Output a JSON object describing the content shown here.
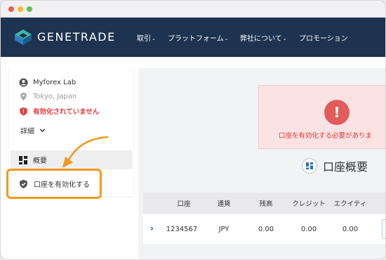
{
  "brand": {
    "name": "GENETRADE"
  },
  "nav": {
    "items": [
      {
        "label": "取引",
        "has_caret": true
      },
      {
        "label": "プラットフォーム",
        "has_caret": true
      },
      {
        "label": "弊社について",
        "has_caret": true
      },
      {
        "label": "プロモーション",
        "has_caret": false
      }
    ],
    "caret": "⌄"
  },
  "profile": {
    "name": "Myforex Lab",
    "location": "Tokyo, Japan",
    "status_warning": "有効化されていません",
    "details_label": "詳細"
  },
  "sidebar_menu": {
    "overview": "概要",
    "activate_account": "口座を有効化する"
  },
  "alert": {
    "icon": "!",
    "message": "口座を有効化する必要がありま"
  },
  "section": {
    "title": "口座概要"
  },
  "accounts_table": {
    "headers": [
      "口座",
      "通貨",
      "残高",
      "クレジット",
      "エクイティ"
    ],
    "rows": [
      {
        "expander": "›",
        "cells": [
          "1234567",
          "JPY",
          "0.00",
          "0.00",
          "0.00"
        ]
      }
    ]
  },
  "colors": {
    "navbar": "#1d3350",
    "accent_orange": "#f29a1f",
    "warning_red": "#e23a3a",
    "alert_bg": "#fbe3e3"
  }
}
